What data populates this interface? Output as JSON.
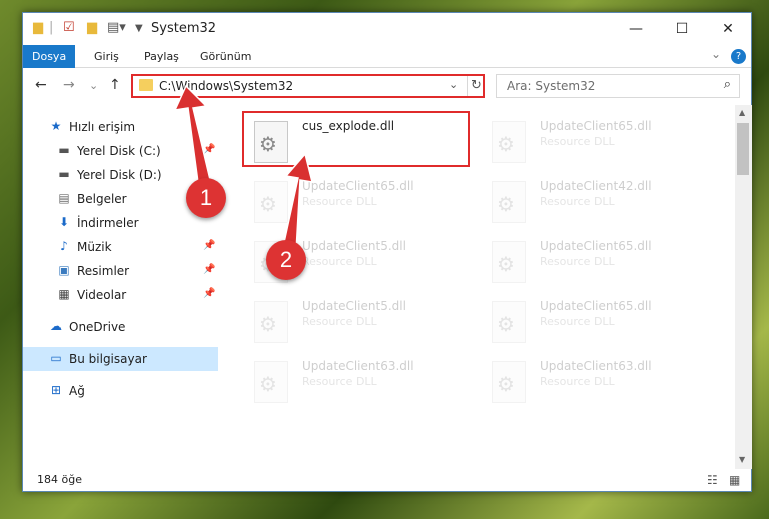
{
  "window": {
    "title": "System32",
    "minimize": "—",
    "maximize": "☐",
    "close": "✕"
  },
  "ribbon": {
    "tabs": [
      {
        "label": "Dosya"
      },
      {
        "label": "Giriş"
      },
      {
        "label": "Paylaş"
      },
      {
        "label": "Görünüm"
      }
    ],
    "collapse": "⌄",
    "help": "?"
  },
  "nav": {
    "back": "←",
    "forward": "→",
    "recent": "⌄",
    "up": "↑",
    "path": "C:\\Windows\\System32",
    "dropdown": "⌄",
    "refresh": "↻",
    "search_placeholder": "Ara: System32",
    "search_icon": "⌕"
  },
  "sidebar": {
    "items": [
      {
        "label": "Hızlı erişim",
        "icon": "star-icon",
        "glyph": "★",
        "color": "#1b6ac9"
      },
      {
        "label": "Yerel Disk (C:)",
        "icon": "drive-icon",
        "glyph": "▬",
        "color": "#555555"
      },
      {
        "label": "Yerel Disk (D:)",
        "icon": "drive-icon",
        "glyph": "▬",
        "color": "#555555"
      },
      {
        "label": "Belgeler",
        "icon": "documents-icon",
        "glyph": "▤",
        "color": "#6b6b6b"
      },
      {
        "label": "İndirmeler",
        "icon": "download-icon",
        "glyph": "⬇",
        "color": "#1b6ac9"
      },
      {
        "label": "Müzik",
        "icon": "music-icon",
        "glyph": "♪",
        "color": "#1b6ac9"
      },
      {
        "label": "Resimler",
        "icon": "pictures-icon",
        "glyph": "▣",
        "color": "#3b7bbf"
      },
      {
        "label": "Videolar",
        "icon": "video-icon",
        "glyph": "▦",
        "color": "#444444"
      },
      {
        "label": "OneDrive",
        "icon": "cloud-icon",
        "glyph": "☁",
        "color": "#1b6ac9"
      },
      {
        "label": "Bu bilgisayar",
        "icon": "computer-icon",
        "glyph": "▭",
        "color": "#1b6ac9"
      },
      {
        "label": "Ağ",
        "icon": "network-icon",
        "glyph": "⊞",
        "color": "#1b6ac9"
      }
    ],
    "pin": "📌"
  },
  "files": [
    {
      "name": "cus_explode.dll",
      "type": ""
    },
    {
      "name": "UpdateClient65.dll",
      "type": "Resource DLL"
    },
    {
      "name": "UpdateClient65.dll",
      "type": "Resource DLL"
    },
    {
      "name": "UpdateClient42.dll",
      "type": "Resource DLL"
    },
    {
      "name": "UpdateClient5.dll",
      "type": "Resource DLL"
    },
    {
      "name": "UpdateClient65.dll",
      "type": "Resource DLL"
    },
    {
      "name": "UpdateClient5.dll",
      "type": "Resource DLL"
    },
    {
      "name": "UpdateClient65.dll",
      "type": "Resource DLL"
    },
    {
      "name": "UpdateClient63.dll",
      "type": "Resource DLL"
    },
    {
      "name": "UpdateClient63.dll",
      "type": "Resource DLL"
    }
  ],
  "status": {
    "count": "184 öğe",
    "details_view": "☷",
    "icons_view": "▦"
  },
  "annotations": {
    "step1": "1",
    "step2": "2",
    "color": "#d93030"
  }
}
